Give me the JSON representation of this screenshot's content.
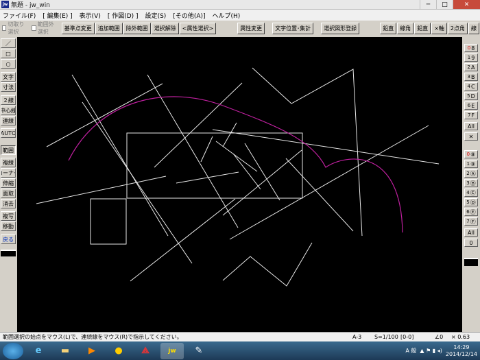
{
  "window": {
    "title": "無題 - jw_win",
    "app_icon": "jw",
    "min": "─",
    "max": "□",
    "close": "✕"
  },
  "menu": [
    "ファイル(F)",
    "[ 編集(E) ]",
    "表示(V)",
    "[ 作図(D) ]",
    "設定(S)",
    "[その他(A)]",
    "ヘルプ(H)"
  ],
  "toolbar": {
    "cb1": "切取り選択",
    "cb2": "範囲外選択",
    "buttons": [
      "基準点変更",
      "追加範囲",
      "除外範囲",
      "選択解除",
      "<属性選択>"
    ],
    "attr_change": "属性変更",
    "text_pos": "文字位置･集計",
    "register": "選択図形登録",
    "right": [
      "鉛直",
      "線角",
      "鉛直",
      "×軸",
      "2点角",
      "線"
    ]
  },
  "left_tools": [
    "／",
    "□",
    "○",
    "文字",
    "寸法",
    "２線",
    "中心線",
    "連線",
    "AUTO",
    "範囲",
    "複線",
    "コーナー",
    "伸縮",
    "面取",
    "消去",
    "複写",
    "移動",
    "戻る"
  ],
  "right_layers_top": [
    {
      "n": "0",
      "l": "8"
    },
    {
      "n": "1",
      "l": "9"
    },
    {
      "n": "2",
      "l": "A"
    },
    {
      "n": "3",
      "l": "B"
    },
    {
      "n": "4",
      "l": "C"
    },
    {
      "n": "5",
      "l": "D"
    },
    {
      "n": "6",
      "l": "E"
    },
    {
      "n": "7",
      "l": "F"
    }
  ],
  "right_layers_bottom": [
    {
      "n": "0",
      "l": "⑧"
    },
    {
      "n": "1",
      "l": "⑨"
    },
    {
      "n": "2",
      "l": "Ⓐ"
    },
    {
      "n": "3",
      "l": "Ⓑ"
    },
    {
      "n": "4",
      "l": "Ⓒ"
    },
    {
      "n": "5",
      "l": "Ⓓ"
    },
    {
      "n": "6",
      "l": "Ⓔ"
    },
    {
      "n": "7",
      "l": "Ⓕ"
    }
  ],
  "right_all": "All",
  "right_x": "✕",
  "right_zero": "0",
  "status": {
    "message": "範囲選択の始点をマウス(L)で、連続線をマウス(R)で指示してください。",
    "paper": "A-3",
    "scale": "S=1/100",
    "layer": "[0-0]",
    "angle": "∠0",
    "zoom": "× 0.63"
  },
  "taskbar": {
    "ime": "A 般",
    "time": "14:29",
    "date": "2014/12/14"
  },
  "colors": {
    "canvas": "#000000",
    "line": "#e8e8e8",
    "arc": "#c020a0"
  }
}
